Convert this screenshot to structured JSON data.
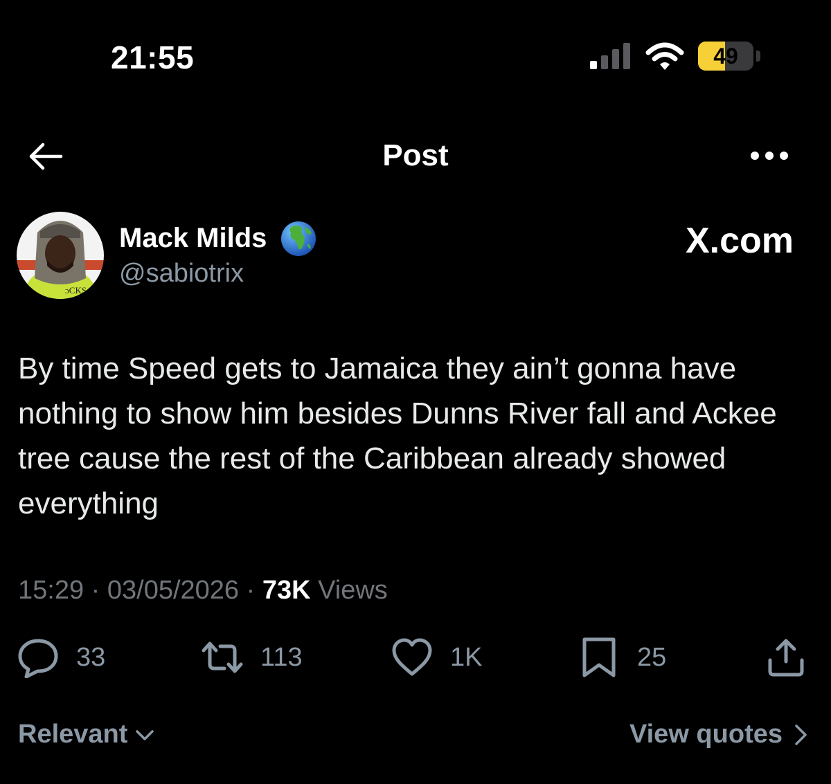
{
  "status_bar": {
    "time": "21:55",
    "signal_bars_active": 1,
    "signal_bars_total": 4,
    "battery_level": "49",
    "battery_fraction": 0.49,
    "battery_color": "#f7d038"
  },
  "header": {
    "title": "Post",
    "back_icon": "arrow-left-icon",
    "more_icon": "more-horizontal-icon"
  },
  "author": {
    "display_name": "Mack Milds",
    "handle": "@sabiotrix",
    "badge_icon": "globe-emoji"
  },
  "watermark": "X.com",
  "post": {
    "text": "By time Speed gets to Jamaica they ain’t gonna have nothing to show him besides Dunns River fall and Ackee tree cause the rest of the Caribbean already showed everything",
    "time": "15:29",
    "separator": "·",
    "date": "03/05/2026",
    "views_count": "73K",
    "views_label": "Views"
  },
  "actions": {
    "reply_count": "33",
    "repost_count": "113",
    "like_count": "1K",
    "bookmark_count": "25"
  },
  "footer": {
    "sort_label": "Relevant",
    "view_quotes_label": "View quotes"
  },
  "colors": {
    "background": "#000000",
    "text_primary": "#e7e9ea",
    "text_secondary": "#71767b"
  }
}
